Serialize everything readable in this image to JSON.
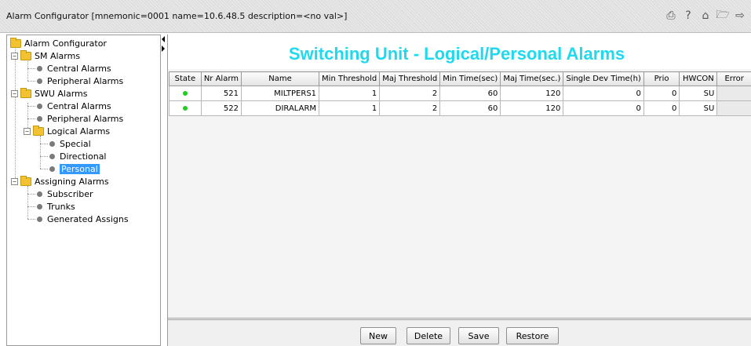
{
  "window": {
    "title": "Alarm Configurator [mnemonic=0001 name=10.6.48.5 description=<no val>]",
    "icons": [
      "print-icon",
      "help-icon",
      "home-icon",
      "open-folder-icon",
      "exit-icon"
    ]
  },
  "tree": {
    "root": "Alarm Configurator",
    "sm_alarms": "SM Alarms",
    "sm_central": "Central Alarms",
    "sm_peripheral": "Peripheral Alarms",
    "swu_alarms": "SWU Alarms",
    "swu_central": "Central Alarms",
    "swu_peripheral": "Peripheral Alarms",
    "logical_alarms": "Logical Alarms",
    "special": "Special",
    "directional": "Directional",
    "personal": "Personal",
    "assigning_alarms": "Assigning Alarms",
    "subscriber": "Subscriber",
    "trunks": "Trunks",
    "generated_assigns": "Generated Assigns"
  },
  "main": {
    "heading": "Switching Unit - Logical/Personal Alarms",
    "columns": [
      "State",
      "Nr Alarm",
      "Name",
      "Min Threshold",
      "Maj Threshold",
      "Min Time(sec)",
      "Maj Time(sec.)",
      "Single Dev Time(h)",
      "Prio",
      "HWCON",
      "Error"
    ],
    "rows": [
      {
        "state": "green",
        "nr_alarm": "521",
        "name": "MILTPERS1",
        "min_threshold": "1",
        "maj_threshold": "2",
        "min_time": "60",
        "maj_time": "120",
        "single_dev_time": "0",
        "prio": "0",
        "hwcon": "SU",
        "error": ""
      },
      {
        "state": "green",
        "nr_alarm": "522",
        "name": "DIRALARM",
        "min_threshold": "1",
        "maj_threshold": "2",
        "min_time": "60",
        "maj_time": "120",
        "single_dev_time": "0",
        "prio": "0",
        "hwcon": "SU",
        "error": ""
      }
    ]
  },
  "buttons": {
    "new": "New",
    "delete": "Delete",
    "save": "Save",
    "restore": "Restore"
  },
  "colors": {
    "heading": "#1fd9ee",
    "selection": "#3399ff",
    "state_ok": "#22cc22"
  }
}
